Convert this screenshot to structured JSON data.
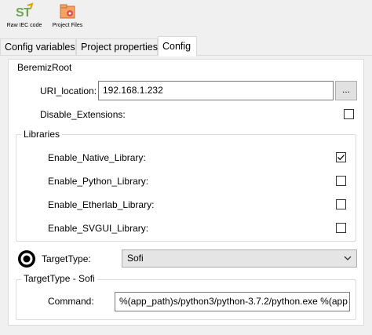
{
  "toolbar": {
    "raw_iec": {
      "label": "Raw IEC code",
      "icon": "st-code-icon"
    },
    "project_files": {
      "label": "Project Files",
      "icon": "project-folder-icon"
    }
  },
  "tabs": [
    {
      "label": "Config variables",
      "active": false
    },
    {
      "label": "Project properties",
      "active": false
    },
    {
      "label": "Config",
      "active": true
    }
  ],
  "root": {
    "title": "BeremizRoot",
    "uri_label": "URI_location:",
    "uri_value": "192.168.1.232",
    "browse_label": "...",
    "disable_ext_label": "Disable_Extensions:",
    "disable_ext_checked": false
  },
  "libraries": {
    "title": "Libraries",
    "items": [
      {
        "label": "Enable_Native_Library:",
        "checked": true
      },
      {
        "label": "Enable_Python_Library:",
        "checked": false
      },
      {
        "label": "Enable_Etherlab_Library:",
        "checked": false
      },
      {
        "label": "Enable_SVGUI_Library:",
        "checked": false
      }
    ]
  },
  "target": {
    "type_label": "TargetType:",
    "type_value": "Sofi",
    "group_title": "TargetType - Sofi",
    "command_label": "Command:",
    "command_value": "%(app_path)s/python3/python-3.7.2/python.exe %(app"
  }
}
